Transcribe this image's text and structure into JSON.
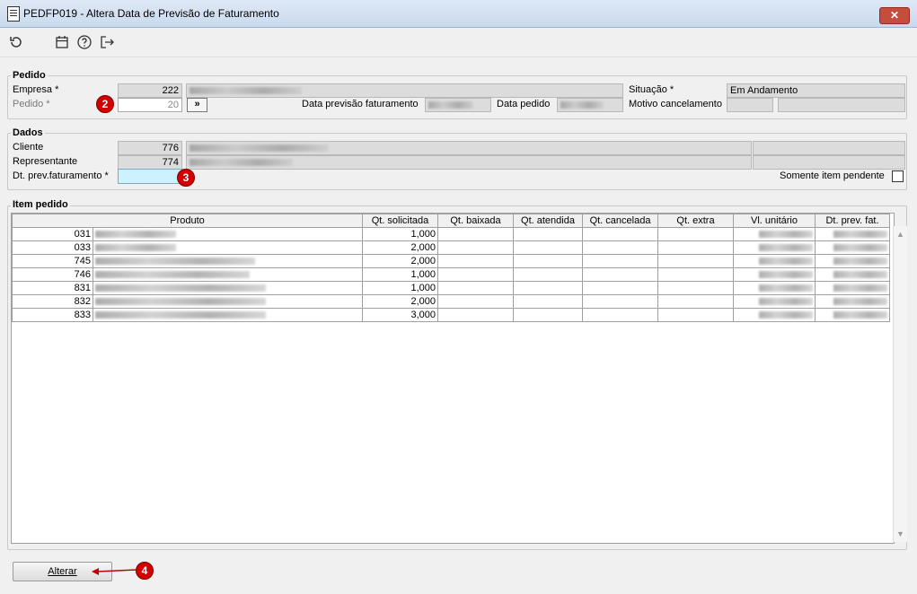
{
  "window": {
    "title": "PEDFP019 - Altera Data de Previsão de Faturamento",
    "close_label": "✕"
  },
  "toolbar": {
    "icons": [
      "refresh-icon",
      "calendar-icon",
      "help-icon",
      "exit-icon"
    ]
  },
  "pedido": {
    "group_title": "Pedido",
    "empresa_label": "Empresa *",
    "empresa_value": "222",
    "pedido_label": "Pedido *",
    "pedido_value": "20",
    "nav_button": "»",
    "data_prev_label": "Data previsão faturamento",
    "data_pedido_label": "Data pedido",
    "situacao_label": "Situação *",
    "situacao_value": "Em Andamento",
    "motivo_label": "Motivo cancelamento"
  },
  "dados": {
    "group_title": "Dados",
    "cliente_label": "Cliente",
    "cliente_value": "776",
    "representante_label": "Representante",
    "representante_value": "774",
    "dt_prev_label": "Dt. prev.faturamento *",
    "dt_prev_value": "",
    "somente_label": "Somente item pendente"
  },
  "item_pedido": {
    "group_title": "Item pedido",
    "columns": [
      "Produto",
      "Qt. solicitada",
      "Qt. baixada",
      "Qt. atendida",
      "Qt. cancelada",
      "Qt. extra",
      "Vl. unitário",
      "Dt. prev. fat."
    ],
    "rows": [
      {
        "code": "031",
        "qt_solicitada": "1,000"
      },
      {
        "code": "033",
        "qt_solicitada": "2,000"
      },
      {
        "code": "745",
        "qt_solicitada": "2,000"
      },
      {
        "code": "746",
        "qt_solicitada": "1,000"
      },
      {
        "code": "831",
        "qt_solicitada": "1,000"
      },
      {
        "code": "832",
        "qt_solicitada": "2,000"
      },
      {
        "code": "833",
        "qt_solicitada": "3,000"
      }
    ]
  },
  "annotations": {
    "badge2": "2",
    "badge3": "3",
    "badge4": "4"
  },
  "footer": {
    "alterar_label": "Alterar"
  },
  "colors": {
    "highlight_field": "#ccf2ff",
    "badge": "#d40000",
    "close": "#c64c3e"
  }
}
